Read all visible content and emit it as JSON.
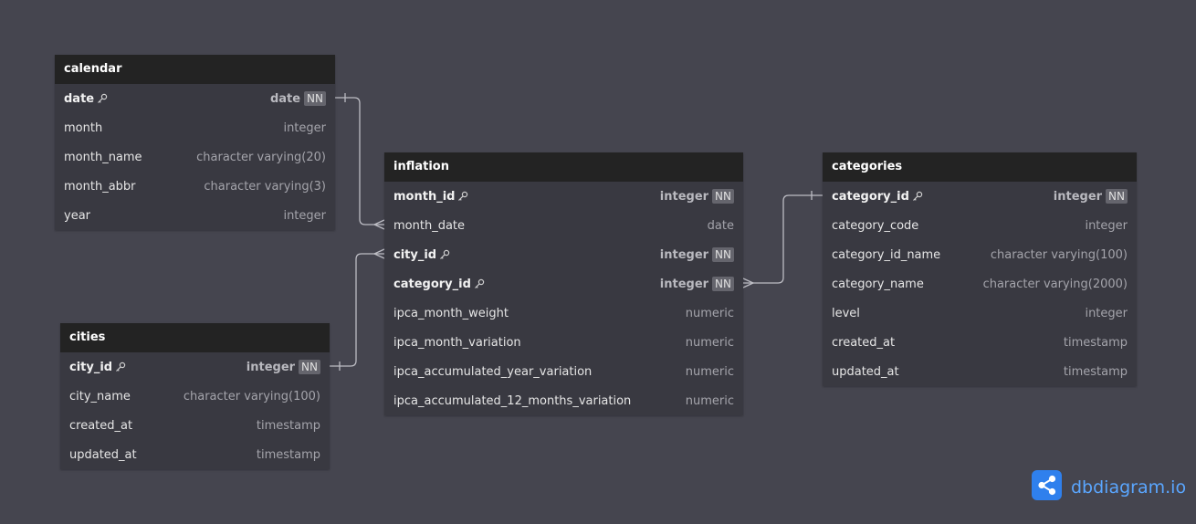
{
  "tables": {
    "calendar": {
      "title": "calendar",
      "fields": [
        {
          "name": "date",
          "type": "date",
          "nn": "NN"
        },
        {
          "name": "month",
          "type": "integer"
        },
        {
          "name": "month_name",
          "type": "character varying(20)"
        },
        {
          "name": "month_abbr",
          "type": "character varying(3)"
        },
        {
          "name": "year",
          "type": "integer"
        }
      ]
    },
    "inflation": {
      "title": "inflation",
      "fields": [
        {
          "name": "month_id",
          "type": "integer",
          "nn": "NN"
        },
        {
          "name": "month_date",
          "type": "date"
        },
        {
          "name": "city_id",
          "type": "integer",
          "nn": "NN"
        },
        {
          "name": "category_id",
          "type": "integer",
          "nn": "NN"
        },
        {
          "name": "ipca_month_weight",
          "type": "numeric"
        },
        {
          "name": "ipca_month_variation",
          "type": "numeric"
        },
        {
          "name": "ipca_accumulated_year_variation",
          "type": "numeric"
        },
        {
          "name": "ipca_accumulated_12_months_variation",
          "type": "numeric"
        }
      ]
    },
    "cities": {
      "title": "cities",
      "fields": [
        {
          "name": "city_id",
          "type": "integer",
          "nn": "NN"
        },
        {
          "name": "city_name",
          "type": "character varying(100)"
        },
        {
          "name": "created_at",
          "type": "timestamp"
        },
        {
          "name": "updated_at",
          "type": "timestamp"
        }
      ]
    },
    "categories": {
      "title": "categories",
      "fields": [
        {
          "name": "category_id",
          "type": "integer",
          "nn": "NN"
        },
        {
          "name": "category_code",
          "type": "integer"
        },
        {
          "name": "category_id_name",
          "type": "character varying(100)"
        },
        {
          "name": "category_name",
          "type": "character varying(2000)"
        },
        {
          "name": "level",
          "type": "integer"
        },
        {
          "name": "created_at",
          "type": "timestamp"
        },
        {
          "name": "updated_at",
          "type": "timestamp"
        }
      ]
    }
  },
  "brand": {
    "name": "dbdiagram.io",
    "icon": "share-nodes-icon"
  },
  "colors": {
    "background": "#45454f",
    "header": "#232323",
    "body": "#393941",
    "link": "#bdbdc4",
    "brand": "#2f80ed"
  }
}
